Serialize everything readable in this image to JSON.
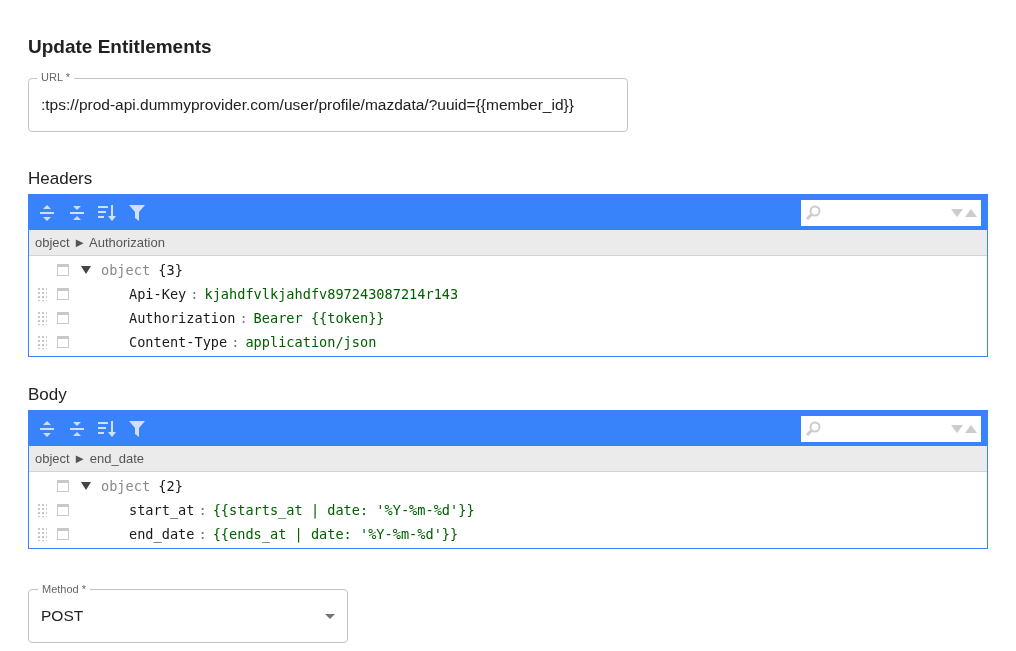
{
  "title": "Update Entitlements",
  "url": {
    "label": "URL *",
    "value": ":tps://prod-api.dummyprovider.com/user/profile/mazdata/?uuid={{member_id}}"
  },
  "editors": [
    {
      "label": "Headers",
      "breadcrumb": "object ► Authorization",
      "root": {
        "key": "object",
        "count": "{3}",
        "expanded": true,
        "children": [
          {
            "key": "Api-Key",
            "separator": ":",
            "value": "kjahdfvlkjahdfv897243087214r143"
          },
          {
            "key": "Authorization",
            "separator": ":",
            "value": "Bearer {{token}}"
          },
          {
            "key": "Content-Type",
            "separator": ":",
            "value": "application/json"
          }
        ]
      }
    },
    {
      "label": "Body",
      "breadcrumb": "object ► end_date",
      "root": {
        "key": "object",
        "count": "{2}",
        "expanded": true,
        "children": [
          {
            "key": "start_at",
            "separator": ":",
            "value": "{{starts_at | date: '%Y-%m-%d'}}"
          },
          {
            "key": "end_date",
            "separator": ":",
            "value": "{{ends_at | date: '%Y-%m-%d'}}"
          }
        ]
      }
    }
  ],
  "method": {
    "label": "Method *",
    "value": "POST"
  }
}
